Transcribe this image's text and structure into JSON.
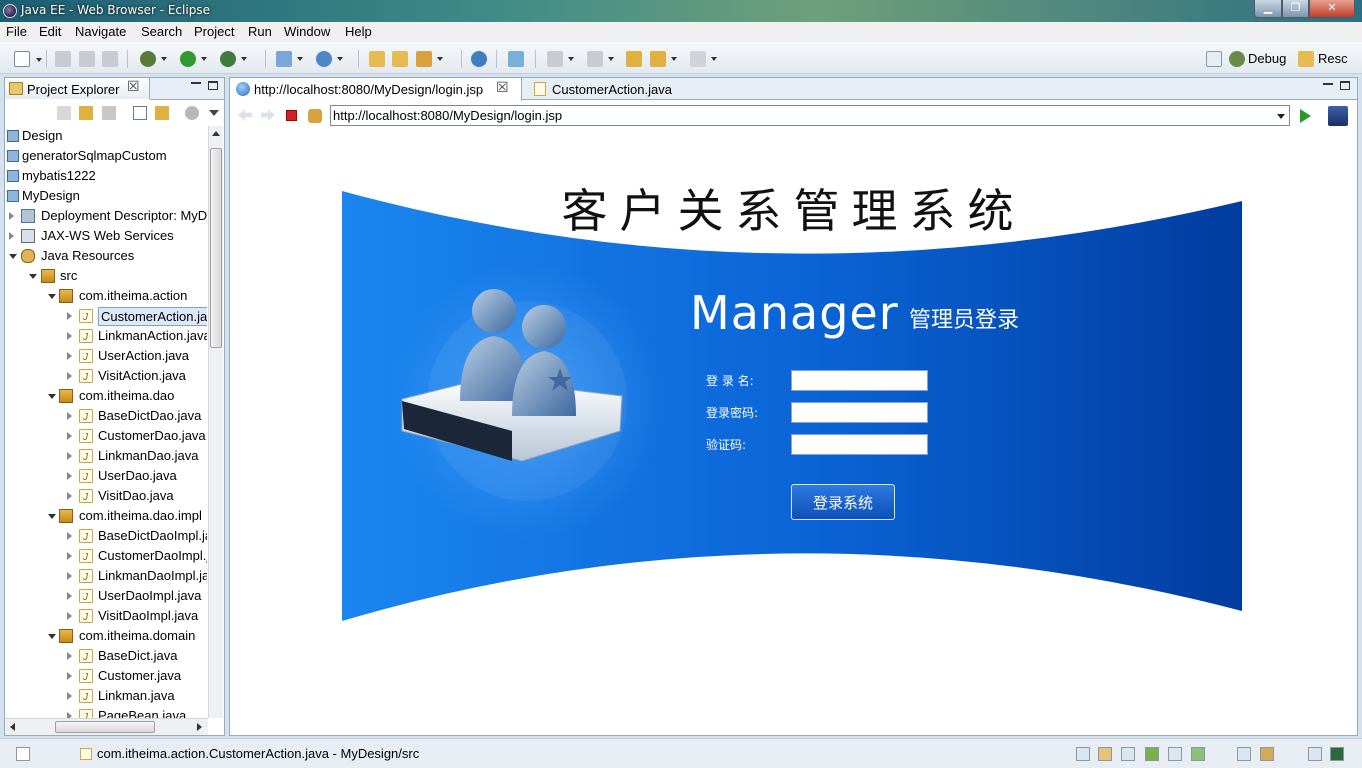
{
  "window": {
    "title": "Java EE - Web Browser - Eclipse",
    "minimize": "▁",
    "maximize": "❐",
    "close": "✕"
  },
  "menu": [
    "File",
    "Edit",
    "Navigate",
    "Search",
    "Project",
    "Run",
    "Window",
    "Help"
  ],
  "perspectives": {
    "debug": "Debug",
    "resource": "Resc"
  },
  "project_explorer": {
    "tab_label": "Project Explorer",
    "tab_close": "☒",
    "items": [
      {
        "label": "Design",
        "level": 0,
        "icon": "project-icon",
        "twisty": "none"
      },
      {
        "label": "generatorSqlmapCustom",
        "level": 0,
        "icon": "project-icon",
        "twisty": "none"
      },
      {
        "label": "mybatis1222",
        "level": 0,
        "icon": "project-icon",
        "twisty": "none"
      },
      {
        "label": "MyDesign",
        "level": 0,
        "icon": "project-icon",
        "twisty": "none"
      },
      {
        "label": "Deployment Descriptor: MyDesign",
        "level": 1,
        "icon": "deployment-descriptor-icon",
        "twisty": "closed"
      },
      {
        "label": "JAX-WS Web Services",
        "level": 1,
        "icon": "web-services-icon",
        "twisty": "closed"
      },
      {
        "label": "Java Resources",
        "level": 1,
        "icon": "java-resources-icon",
        "twisty": "open"
      },
      {
        "label": "src",
        "level": 2,
        "icon": "source-folder-icon",
        "twisty": "open"
      },
      {
        "label": "com.itheima.action",
        "level": 3,
        "icon": "package-icon",
        "twisty": "open"
      },
      {
        "label": "CustomerAction.java",
        "level": 4,
        "icon": "java-file-icon",
        "twisty": "closed",
        "selected": true
      },
      {
        "label": "LinkmanAction.java",
        "level": 4,
        "icon": "java-file-icon",
        "twisty": "closed"
      },
      {
        "label": "UserAction.java",
        "level": 4,
        "icon": "java-file-icon",
        "twisty": "closed"
      },
      {
        "label": "VisitAction.java",
        "level": 4,
        "icon": "java-file-icon",
        "twisty": "closed"
      },
      {
        "label": "com.itheima.dao",
        "level": 3,
        "icon": "package-icon",
        "twisty": "open"
      },
      {
        "label": "BaseDictDao.java",
        "level": 4,
        "icon": "java-file-icon",
        "twisty": "closed"
      },
      {
        "label": "CustomerDao.java",
        "level": 4,
        "icon": "java-file-icon",
        "twisty": "closed"
      },
      {
        "label": "LinkmanDao.java",
        "level": 4,
        "icon": "java-file-icon",
        "twisty": "closed"
      },
      {
        "label": "UserDao.java",
        "level": 4,
        "icon": "java-file-icon",
        "twisty": "closed"
      },
      {
        "label": "VisitDao.java",
        "level": 4,
        "icon": "java-file-icon",
        "twisty": "closed"
      },
      {
        "label": "com.itheima.dao.impl",
        "level": 3,
        "icon": "package-icon",
        "twisty": "open"
      },
      {
        "label": "BaseDictDaoImpl.java",
        "level": 4,
        "icon": "java-file-icon",
        "twisty": "closed"
      },
      {
        "label": "CustomerDaoImpl.java",
        "level": 4,
        "icon": "java-file-icon",
        "twisty": "closed"
      },
      {
        "label": "LinkmanDaoImpl.java",
        "level": 4,
        "icon": "java-file-icon",
        "twisty": "closed"
      },
      {
        "label": "UserDaoImpl.java",
        "level": 4,
        "icon": "java-file-icon",
        "twisty": "closed"
      },
      {
        "label": "VisitDaoImpl.java",
        "level": 4,
        "icon": "java-file-icon",
        "twisty": "closed"
      },
      {
        "label": "com.itheima.domain",
        "level": 3,
        "icon": "package-icon",
        "twisty": "open"
      },
      {
        "label": "BaseDict.java",
        "level": 4,
        "icon": "java-file-icon",
        "twisty": "closed"
      },
      {
        "label": "Customer.java",
        "level": 4,
        "icon": "java-file-icon",
        "twisty": "closed"
      },
      {
        "label": "Linkman.java",
        "level": 4,
        "icon": "java-file-icon",
        "twisty": "closed"
      },
      {
        "label": "PageBean.java",
        "level": 4,
        "icon": "java-file-icon",
        "twisty": "closed"
      }
    ]
  },
  "editor": {
    "tabs": [
      {
        "label": "http://localhost:8080/MyDesign/login.jsp",
        "icon": "globe-icon",
        "active": true,
        "close": "☒"
      },
      {
        "label": "CustomerAction.java",
        "icon": "java-file-icon",
        "active": false
      }
    ],
    "url": "http://localhost:8080/MyDesign/login.jsp"
  },
  "page": {
    "system_title": "客户关系管理系统",
    "manager_title": "Manager",
    "manager_subtitle": "管理员登录",
    "username_label": "登 录 名:",
    "password_label": "登录密码:",
    "captcha_label": "验证码:",
    "username_value": "",
    "password_value": "",
    "captcha_value": "",
    "login_button": "登录系统",
    "colors": {
      "banner_light": "#1a86f0",
      "banner_dark": "#003c9e",
      "accent": "#ffffff"
    }
  },
  "status": {
    "text": "com.itheima.action.CustomerAction.java - MyDesign/src"
  }
}
